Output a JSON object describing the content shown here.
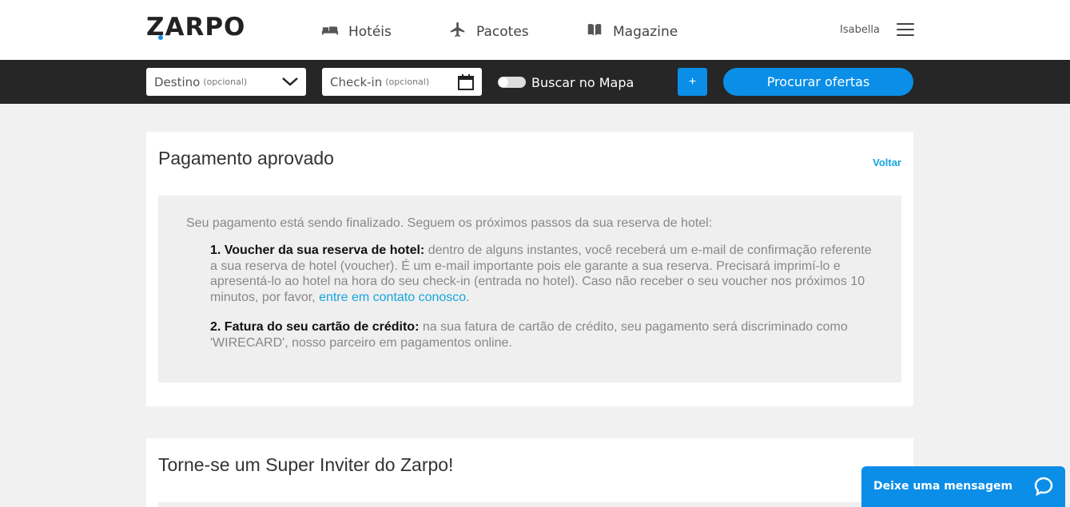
{
  "header": {
    "logo": "ZARPO",
    "nav": [
      {
        "label": "Hotéis",
        "icon": "bed-icon"
      },
      {
        "label": "Pacotes",
        "icon": "airplane-icon"
      },
      {
        "label": "Magazine",
        "icon": "book-icon"
      }
    ],
    "user": "Isabella",
    "menu_icon": "hamburger-menu-icon"
  },
  "search": {
    "destination_label": "Destino",
    "destination_optional": "(opcional)",
    "checkin_label": "Check-in",
    "checkin_optional": "(opcional)",
    "map_toggle_label": "Buscar no Mapa",
    "plus_label": "+",
    "submit_label": "Procurar ofertas"
  },
  "payment": {
    "title": "Pagamento aprovado",
    "back_label": "Voltar",
    "intro": "Seu pagamento está sendo finalizado. Seguem os próximos passos da sua reserva de hotel:",
    "step1_title": "1. Voucher da sua reserva de hotel:",
    "step1_text": " dentro de alguns instantes, você receberá um e-mail de confirmação referente a sua reserva de hotel (voucher). É um e-mail importante pois ele garante a sua reserva. Precisará imprimí-lo e apresentá-lo ao hotel na hora do seu check-in (entrada no hotel). Caso não receber o seu voucher nos próximos 10 minutos, por favor, ",
    "step1_link": "entre em contato conosco",
    "step1_end": ".",
    "step2_title": "2. Fatura do seu cartão de crédito:",
    "step2_text": " na sua fatura de cartão de crédito, seu pagamento será discriminado como 'WIRECARD', nosso parceiro em pagamentos online."
  },
  "inviter": {
    "title": "Torne-se um Super Inviter do Zarpo!"
  },
  "chat": {
    "label": "Deixe uma mensagem",
    "icon": "chat-bubble-icon"
  },
  "colors": {
    "accent": "#0a8ee8",
    "link": "#16a6de",
    "searchbar_bg": "#262626",
    "page_bg": "#f1f1f1"
  }
}
